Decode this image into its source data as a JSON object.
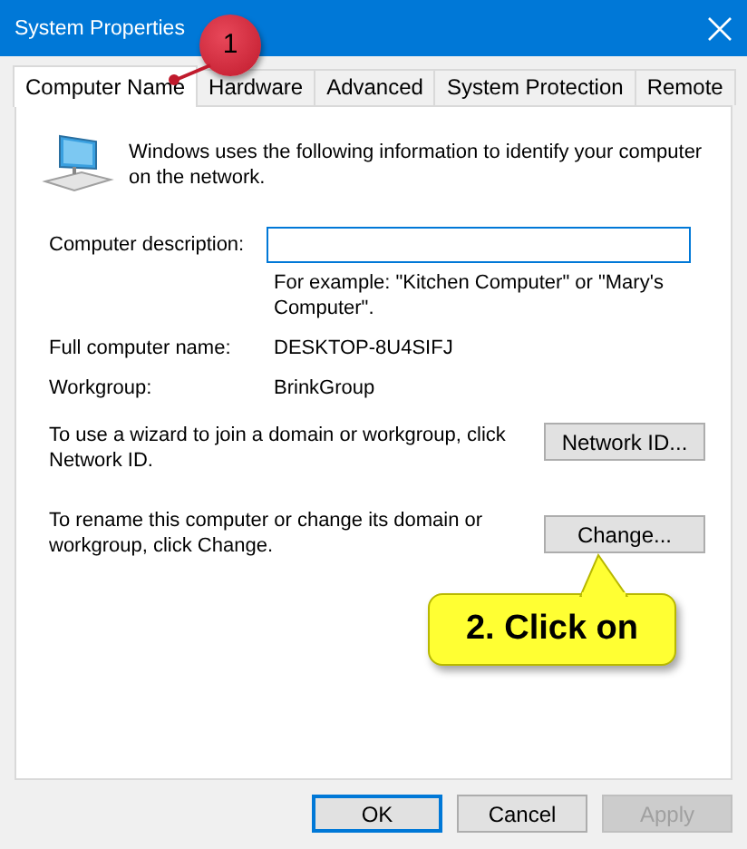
{
  "window": {
    "title": "System Properties"
  },
  "tabs": [
    {
      "label": "Computer Name",
      "selected": true
    },
    {
      "label": "Hardware",
      "selected": false
    },
    {
      "label": "Advanced",
      "selected": false
    },
    {
      "label": "System Protection",
      "selected": false
    },
    {
      "label": "Remote",
      "selected": false
    }
  ],
  "intro": "Windows uses the following information to identify your computer on the network.",
  "description_field": {
    "label": "Computer description:",
    "hint": "For example: \"Kitchen Computer\" or \"Mary's Computer\"."
  },
  "info_rows": [
    {
      "label": "Full computer name:",
      "value": "DESKTOP-8U4SIFJ"
    },
    {
      "label": "Workgroup:",
      "value": "BrinkGroup"
    }
  ],
  "sections": [
    {
      "text": "To use a wizard to join a domain or workgroup, click Network ID.",
      "button": "Network ID..."
    },
    {
      "text": "To rename this computer or change its domain or workgroup, click Change.",
      "button": "Change..."
    }
  ],
  "buttons": [
    {
      "label": "OK",
      "default": true,
      "disabled": false
    },
    {
      "label": "Cancel",
      "default": false,
      "disabled": false
    },
    {
      "label": "Apply",
      "default": false,
      "disabled": true
    }
  ],
  "annotations": [
    {
      "kind": "marker",
      "text": "1"
    },
    {
      "kind": "callout",
      "text": "2. Click on"
    }
  ]
}
